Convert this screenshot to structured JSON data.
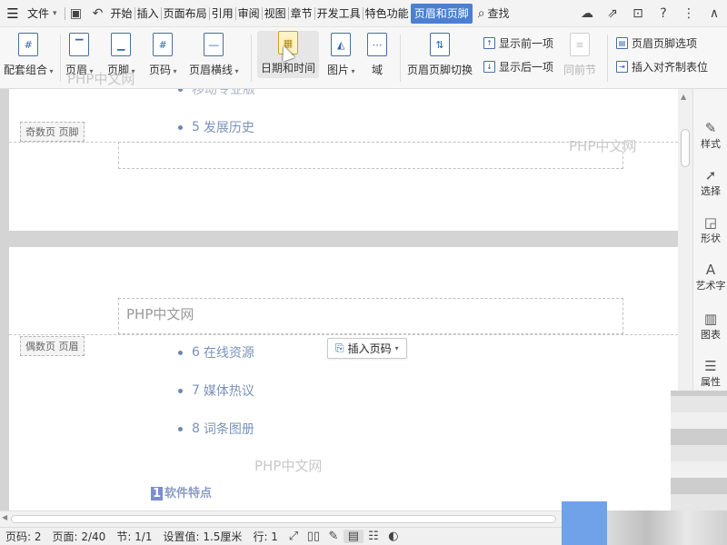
{
  "menubar": {
    "file_label": "文件",
    "tabs": [
      {
        "label": "开始"
      },
      {
        "label": "插入"
      },
      {
        "label": "页面布局"
      },
      {
        "label": "引用"
      },
      {
        "label": "审阅"
      },
      {
        "label": "视图"
      },
      {
        "label": "章节"
      },
      {
        "label": "开发工具"
      },
      {
        "label": "特色功能"
      }
    ],
    "active_tab": "页眉和页脚",
    "search_label": "查找",
    "accent_color": "#4a7fd4"
  },
  "ribbon": {
    "combo": {
      "label": "配套组合",
      "glyph": "#"
    },
    "header": {
      "label": "页眉"
    },
    "footer": {
      "label": "页脚"
    },
    "page_number": {
      "label": "页码",
      "glyph": "#"
    },
    "header_line": {
      "label": "页眉横线"
    },
    "datetime": {
      "label": "日期和时间"
    },
    "picture": {
      "label": "图片"
    },
    "field": {
      "label": "域"
    },
    "switch": {
      "label": "页眉页脚切换"
    },
    "show_prev": {
      "label": "显示前一项"
    },
    "show_next": {
      "label": "显示后一项"
    },
    "same_prev": {
      "label": "同前节"
    },
    "hf_options": {
      "label": "页眉页脚选项"
    },
    "align_tab": {
      "label": "插入对齐制表位"
    }
  },
  "watermark_text": "PHP中文网",
  "document": {
    "page1": {
      "truncated_item": "移动专业版",
      "item5": {
        "num": "5",
        "text": "发展历史"
      },
      "footer_label": "奇数页 页脚"
    },
    "page2": {
      "header_text": "PHP中文网",
      "header_label": "偶数页 页眉",
      "insert_page_number": "插入页码",
      "items": [
        {
          "num": "6",
          "text": "在线资源"
        },
        {
          "num": "7",
          "text": "媒体热议"
        },
        {
          "num": "8",
          "text": "词条图册"
        }
      ],
      "watermark": "PHP中文网",
      "section_num": "1",
      "section_title": "软件特点"
    }
  },
  "right_panel": [
    {
      "label": "样式",
      "icon": "pencil-icon"
    },
    {
      "label": "选择",
      "icon": "cursor-icon"
    },
    {
      "label": "形状",
      "icon": "shapes-icon"
    },
    {
      "label": "艺术字",
      "icon": "wordart-icon"
    },
    {
      "label": "图表",
      "icon": "chart-icon"
    },
    {
      "label": "属性",
      "icon": "sliders-icon"
    }
  ],
  "statusbar": {
    "page_no": "页码: 2",
    "page": "页面: 2/40",
    "section": "节: 1/1",
    "setting": "设置值: 1.5厘米",
    "line": "行: 1"
  }
}
